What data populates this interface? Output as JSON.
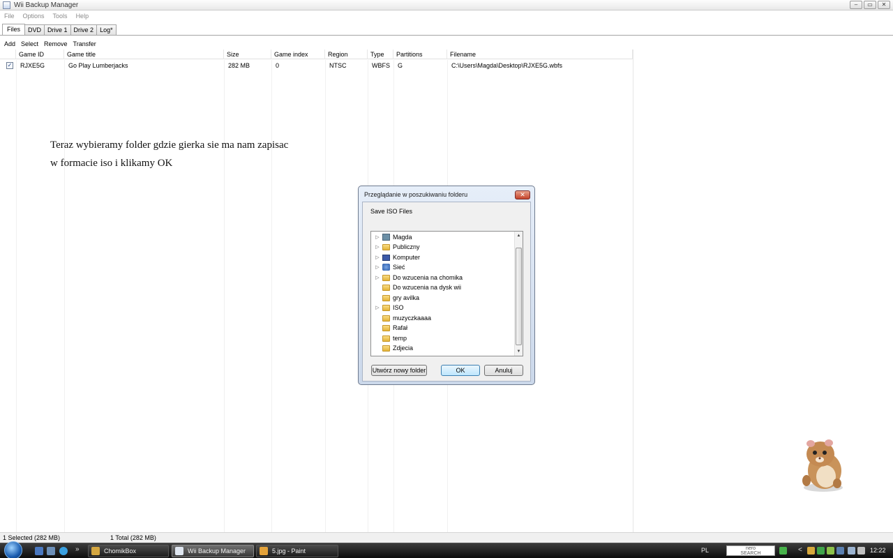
{
  "window": {
    "title": "Wii Backup Manager",
    "controls": [
      "–",
      "▭",
      "✕"
    ]
  },
  "menu": [
    "File",
    "Options",
    "Tools",
    "Help"
  ],
  "tabs": [
    "Files",
    "DVD",
    "Drive 1",
    "Drive 2",
    "Log*"
  ],
  "toolbar": [
    "Add",
    "Select",
    "Remove",
    "Transfer"
  ],
  "table": {
    "columns": [
      "Game ID",
      "Game title",
      "Size",
      "Game index",
      "Region",
      "Type",
      "Partitions",
      "Filename"
    ],
    "rows": [
      {
        "checked": true,
        "cells": [
          "RJXE5G",
          "Go Play Lumberjacks",
          "282 MB",
          "0",
          "NTSC",
          "WBFS",
          "G",
          "C:\\Users\\Magda\\Desktop\\RJXE5G.wbfs"
        ]
      }
    ]
  },
  "annotation": {
    "line1": "Teraz wybieramy folder gdzie gierka sie ma nam zapisac",
    "line2": "w formacie iso i klikamy OK"
  },
  "dialog": {
    "title": "Przeglądanie w poszukiwaniu folderu",
    "description": "Save ISO Files",
    "close_label": "✕",
    "tree": [
      {
        "label": "Magda",
        "icon": "user-folder-icon",
        "expandable": true
      },
      {
        "label": "Publiczny",
        "icon": "folder-icon",
        "expandable": true
      },
      {
        "label": "Komputer",
        "icon": "computer-icon",
        "expandable": true
      },
      {
        "label": "Sieć",
        "icon": "network-icon",
        "expandable": true
      },
      {
        "label": "Do wzucenia na chomika",
        "icon": "folder-icon",
        "expandable": true
      },
      {
        "label": "Do wzucenia na dysk wii",
        "icon": "folder-icon",
        "expandable": false
      },
      {
        "label": "gry avilka",
        "icon": "folder-icon",
        "expandable": false
      },
      {
        "label": "ISO",
        "icon": "folder-icon",
        "expandable": true
      },
      {
        "label": "muzyczkaaaa",
        "icon": "folder-icon",
        "expandable": false
      },
      {
        "label": "Rafał",
        "icon": "folder-icon",
        "expandable": false
      },
      {
        "label": "temp",
        "icon": "folder-icon",
        "expandable": false
      },
      {
        "label": "Zdjecia",
        "icon": "folder-icon",
        "expandable": false
      }
    ],
    "buttons": {
      "new_folder": "Utwórz nowy folder",
      "ok": "OK",
      "cancel": "Anuluj"
    }
  },
  "status": {
    "selected": "1 Selected (282 MB)",
    "total": "1 Total (282 MB)"
  },
  "taskbar": {
    "quicklaunch_more": "»",
    "items": [
      {
        "label": "ChomikBox",
        "active": false
      },
      {
        "label": "Wii Backup Manager",
        "active": true
      },
      {
        "label": "5.jpg - Paint",
        "active": false
      }
    ],
    "language": "PL",
    "nero_label": "nero",
    "nero_sublabel": "SEARCH",
    "tray_arrow": "<",
    "clock": "12:22"
  }
}
